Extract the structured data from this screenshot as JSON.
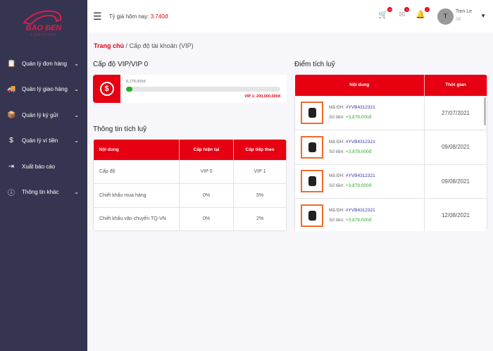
{
  "logo": {
    "line1": "BÃO ĐEN",
    "line2": "LOGISTICS"
  },
  "sidebar": {
    "items": [
      {
        "label": "Quản lý đơn hàng",
        "icon": "clipboard-icon",
        "chevron": true
      },
      {
        "label": "Quản lý giao hàng",
        "icon": "truck-icon",
        "chevron": true
      },
      {
        "label": "Quản lý ký gửi",
        "icon": "box-icon",
        "chevron": true
      },
      {
        "label": "Quản lý ví tiền",
        "icon": "dollar-icon",
        "chevron": true
      },
      {
        "label": "Xuất báo cáo",
        "icon": "export-icon",
        "chevron": false
      },
      {
        "label": "Thông tin khác",
        "icon": "info-icon",
        "chevron": true
      }
    ]
  },
  "header": {
    "rate_label": "Tỷ giá hôm nay:",
    "rate_value": "3.740đ",
    "cart_count": "10",
    "mail_count": "0",
    "notif_count": "1",
    "avatar": "T",
    "user": "Tien Le",
    "balance": "0đ"
  },
  "breadcrumb": {
    "home": "Trang chủ",
    "sep": "/",
    "current": "Cấp độ tài khoản (VIP)"
  },
  "vip": {
    "title": "Cấp độ VIP/VIP 0",
    "amount": "8,278,900đ",
    "progress_percent": 4,
    "target": "VIP 1: 200,000,000đ"
  },
  "info": {
    "title": "Thông tin tích luỹ",
    "headers": [
      "Nội dung",
      "Cấp hiện tại",
      "Cấp tiếp theo"
    ],
    "rows": [
      [
        "Cấp độ",
        "VIP 0",
        "VIP 1"
      ],
      [
        "Chiết khấu mua hàng",
        "0%",
        "5%"
      ],
      [
        "Chiết khấu vận chuyển TQ-VN",
        "0%",
        "2%"
      ]
    ]
  },
  "points": {
    "title": "Điểm tích luỹ",
    "headers": [
      "Nội dung",
      "Thời gian"
    ],
    "order_label": "Mã ĐH:",
    "amount_label": "Số tiền:",
    "rows": [
      {
        "order": "#YVB4312321",
        "amount": "+3,879,000đ",
        "date": "27/07/2021"
      },
      {
        "order": "#YVB4312321",
        "amount": "+3,879,000đ",
        "date": "09/08/2021"
      },
      {
        "order": "#YVB4312321",
        "amount": "+3,879,000đ",
        "date": "09/08/2021"
      },
      {
        "order": "#YVB4312321",
        "amount": "+3,879,000đ",
        "date": "12/08/2021"
      }
    ]
  }
}
